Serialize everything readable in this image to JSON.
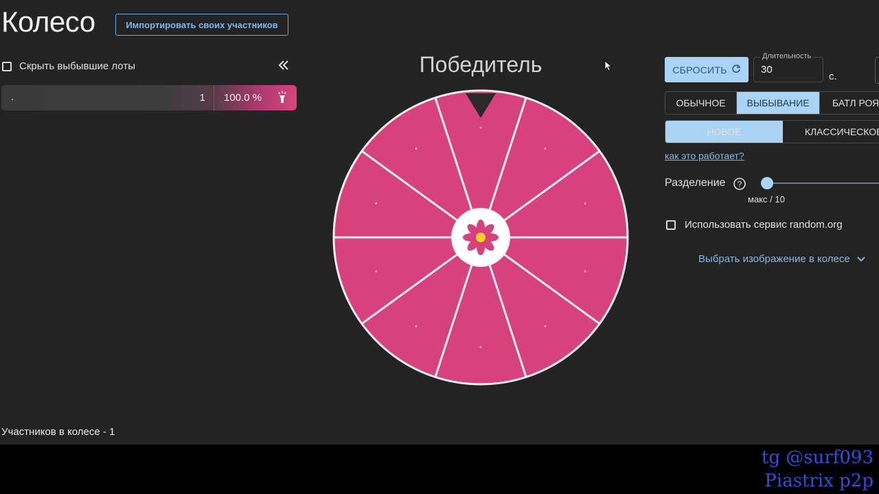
{
  "header": {
    "title": "Колесо",
    "import_button": "Импортировать своих участников"
  },
  "left_panel": {
    "hide_dropped_label": "Скрыть выбывшие лоты",
    "collapse_icon": "double-chevron-left-icon",
    "lots": [
      {
        "name": ".",
        "count": "1",
        "percent": "100.0 %",
        "icon": "torch-icon"
      }
    ],
    "participants_text": "Участников в колесе - 1"
  },
  "wheel": {
    "title": "Победитель",
    "segments": 10,
    "segment_color": "#d6417e",
    "center_icon": "flower-icon",
    "pointer_icon": "triangle-pointer-icon"
  },
  "controls": {
    "reset_label": "СБРОСИТЬ",
    "reset_icon": "refresh-icon",
    "duration_label": "Длительность",
    "duration_value": "30",
    "duration_unit": "с.",
    "modes": [
      "ОБЫЧНОЕ",
      "ВЫБЫВАНИЕ",
      "БАТЛ РОЯЛЬ"
    ],
    "active_mode": "ВЫБЫВАНИЕ",
    "types": [
      "НОВОЕ",
      "КЛАССИЧЕСКОЕ"
    ],
    "active_type": "НОВОЕ",
    "how_it_works": "как это работает?",
    "split_label": "Разделение",
    "split_caption": "макс / 10",
    "random_org_label": "Использовать сервис random.org",
    "image_select_label": "Выбрать изображение в колесе"
  },
  "watermark": {
    "line1": "tg @surf093",
    "line2": "Piastrix p2p"
  },
  "colors": {
    "accent": "#aad3f4",
    "link": "#7fb8e8",
    "wheel_pink": "#d6417e",
    "background": "#232323"
  }
}
